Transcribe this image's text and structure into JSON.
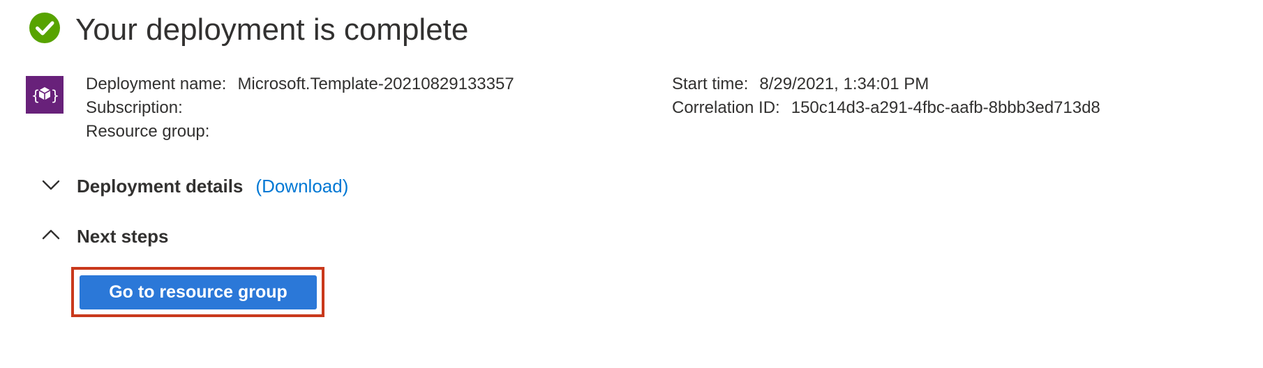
{
  "header": {
    "title": "Your deployment is complete",
    "status_icon": "check-circle-icon",
    "status_color": "#57a300"
  },
  "resource": {
    "icon": "template-deployment-icon",
    "icon_color": "#68217a"
  },
  "deployment_info": {
    "left": [
      {
        "label": "Deployment name:",
        "value": "Microsoft.Template-20210829133357"
      },
      {
        "label": "Subscription:",
        "value": ""
      },
      {
        "label": "Resource group:",
        "value": ""
      }
    ],
    "right": [
      {
        "label": "Start time:",
        "value": "8/29/2021, 1:34:01 PM"
      },
      {
        "label": "Correlation ID:",
        "value": "150c14d3-a291-4fbc-aafb-8bbb3ed713d8"
      }
    ]
  },
  "sections": {
    "details": {
      "title": "Deployment details",
      "link": "(Download)",
      "expanded": false
    },
    "next_steps": {
      "title": "Next steps",
      "expanded": true,
      "button_label": "Go to resource group"
    }
  },
  "colors": {
    "accent": "#0078d4",
    "button": "#2b78d8",
    "highlight": "#c9391c",
    "text": "#323130"
  }
}
